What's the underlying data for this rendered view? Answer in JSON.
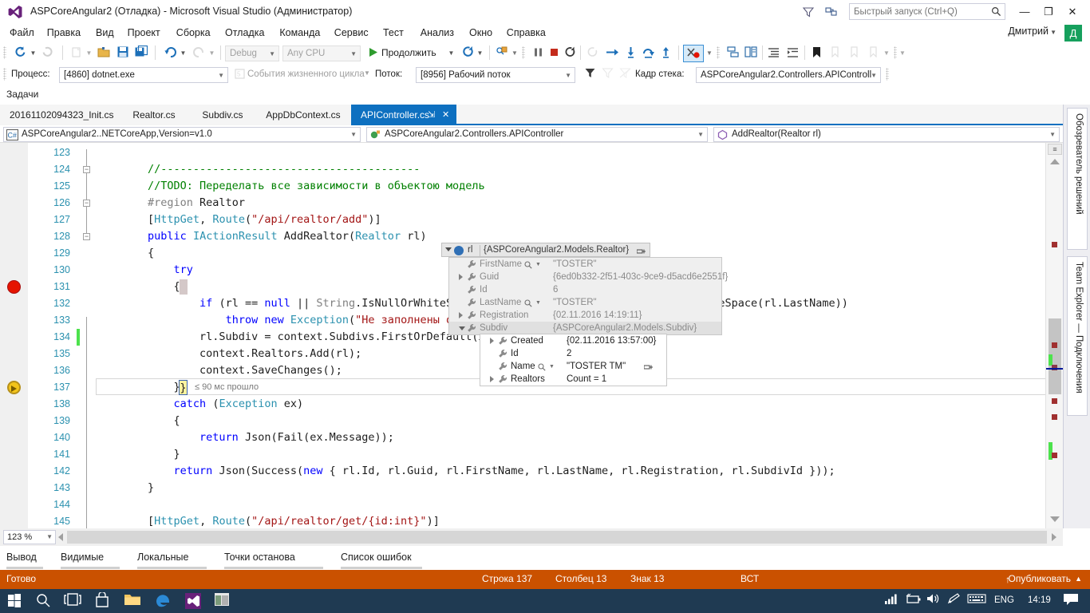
{
  "titlebar": {
    "title": "ASPCoreAngular2 (Отладка) - Microsoft Visual Studio (Администратор)",
    "quick_launch_placeholder": "Быстрый запуск (Ctrl+Q)",
    "minimize": "—",
    "maximize": "❐",
    "close": "✕"
  },
  "menu": {
    "items": [
      "Файл",
      "Правка",
      "Вид",
      "Проект",
      "Сборка",
      "Отладка",
      "Команда",
      "Сервис",
      "Тест",
      "Анализ",
      "Окно",
      "Справка"
    ]
  },
  "account": {
    "name": "Дмитрий",
    "avatar_initial": "Д"
  },
  "toolbar": {
    "config": "Debug",
    "platform": "Any CPU",
    "continue_label": "Продолжить",
    "process_label": "Процесс:",
    "process_value": "[4860] dotnet.exe",
    "lifecycle_label": "События жизненного цикла",
    "thread_label": "Поток:",
    "thread_value": "[8956] Рабочий поток",
    "stackframe_label": "Кадр стека:",
    "stackframe_value": "ASPCoreAngular2.Controllers.APIControll"
  },
  "tasks_label": "Задачи",
  "tabs": {
    "items": [
      {
        "label": "20161102094323_Init.cs",
        "active": false
      },
      {
        "label": "Realtor.cs",
        "active": false
      },
      {
        "label": "Subdiv.cs",
        "active": false
      },
      {
        "label": "AppDbContext.cs",
        "active": false
      },
      {
        "label": "APIController.cs",
        "active": true
      }
    ],
    "pin_glyph": "⇲",
    "close_glyph": "✕"
  },
  "navbar": {
    "project": "ASPCoreAngular2..NETCoreApp,Version=v1.0",
    "type": "ASPCoreAngular2.Controllers.APIController",
    "member": "AddRealtor(Realtor rl)"
  },
  "editor": {
    "zoom": "123 %",
    "lines": [
      {
        "num": "123",
        "segments": []
      },
      {
        "num": "124",
        "fold": "minus",
        "segments": [
          {
            "t": "        //----------------------------------------",
            "c": "c"
          }
        ]
      },
      {
        "num": "125",
        "segments": [
          {
            "t": "        //TODO: Переделать все зависимости в объектою модель",
            "c": "c"
          }
        ]
      },
      {
        "num": "126",
        "fold": "minus",
        "segments": [
          {
            "t": "        #region",
            "c": "p"
          },
          {
            "t": " Realtor",
            "c": "n"
          }
        ]
      },
      {
        "num": "127",
        "segments": [
          {
            "t": "        [",
            "c": "n"
          },
          {
            "t": "HttpGet",
            "c": "t"
          },
          {
            "t": ", ",
            "c": "n"
          },
          {
            "t": "Route",
            "c": "t"
          },
          {
            "t": "(",
            "c": "n"
          },
          {
            "t": "\"/api/realtor/add\"",
            "c": "s"
          },
          {
            "t": ")]",
            "c": "n"
          }
        ]
      },
      {
        "num": "128",
        "fold": "minus",
        "segments": [
          {
            "t": "        ",
            "c": "n"
          },
          {
            "t": "public",
            "c": "k"
          },
          {
            "t": " ",
            "c": "n"
          },
          {
            "t": "IActionResult",
            "c": "t"
          },
          {
            "t": " AddRealtor(",
            "c": "n"
          },
          {
            "t": "Realtor",
            "c": "t"
          },
          {
            "t": " rl)",
            "c": "n"
          }
        ]
      },
      {
        "num": "129",
        "segments": [
          {
            "t": "        {",
            "c": "n"
          }
        ]
      },
      {
        "num": "130",
        "segments": [
          {
            "t": "            ",
            "c": "n"
          },
          {
            "t": "try",
            "c": "k"
          }
        ]
      },
      {
        "num": "131",
        "breakpoint": true,
        "segments": [
          {
            "t": "            {",
            "c": "n"
          }
        ]
      },
      {
        "num": "132",
        "segments": [
          {
            "t": "                ",
            "c": "n"
          },
          {
            "t": "if",
            "c": "k"
          },
          {
            "t": " (rl == ",
            "c": "n"
          },
          {
            "t": "null",
            "c": "k"
          },
          {
            "t": " || ",
            "c": "n"
          },
          {
            "t": "String",
            "c": "p"
          },
          {
            "t": ".IsNullOrWhiteSpace(rl.FirstName) || ",
            "c": "n"
          },
          {
            "t": "String",
            "c": "p"
          },
          {
            "t": ".IsNullOrWhiteSpace(rl.LastName))",
            "c": "n"
          }
        ]
      },
      {
        "num": "133",
        "segments": [
          {
            "t": "                    ",
            "c": "n"
          },
          {
            "t": "throw",
            "c": "k"
          },
          {
            "t": " ",
            "c": "n"
          },
          {
            "t": "new",
            "c": "k"
          },
          {
            "t": " ",
            "c": "n"
          },
          {
            "t": "Exception",
            "c": "t"
          },
          {
            "t": "(",
            "c": "n"
          },
          {
            "t": "\"Не заполнены обязательные поля\"",
            "c": "s"
          },
          {
            "t": ");",
            "c": "n"
          }
        ]
      },
      {
        "num": "134",
        "changed": true,
        "segments": [
          {
            "t": "                rl.Subdiv = context.Subdivs.FirstOrDefault(x => x.Id == rl.SubdivId);",
            "c": "n"
          }
        ]
      },
      {
        "num": "135",
        "segments": [
          {
            "t": "                context.Realtors.Add(rl);",
            "c": "n"
          }
        ]
      },
      {
        "num": "136",
        "segments": [
          {
            "t": "                context.SaveChanges();",
            "c": "n"
          }
        ]
      },
      {
        "num": "137",
        "current": true,
        "perftip": "≤ 90 мс прошло",
        "segments": [
          {
            "t": "            }",
            "c": "n"
          }
        ]
      },
      {
        "num": "138",
        "segments": [
          {
            "t": "            ",
            "c": "n"
          },
          {
            "t": "catch",
            "c": "k"
          },
          {
            "t": " (",
            "c": "n"
          },
          {
            "t": "Exception",
            "c": "t"
          },
          {
            "t": " ex)",
            "c": "n"
          }
        ]
      },
      {
        "num": "139",
        "segments": [
          {
            "t": "            {",
            "c": "n"
          }
        ]
      },
      {
        "num": "140",
        "segments": [
          {
            "t": "                ",
            "c": "n"
          },
          {
            "t": "return",
            "c": "k"
          },
          {
            "t": " Json(Fail(ex.Message));",
            "c": "n"
          }
        ]
      },
      {
        "num": "141",
        "segments": [
          {
            "t": "            }",
            "c": "n"
          }
        ]
      },
      {
        "num": "142",
        "segments": [
          {
            "t": "            ",
            "c": "n"
          },
          {
            "t": "return",
            "c": "k"
          },
          {
            "t": " Json(Success(",
            "c": "n"
          },
          {
            "t": "new",
            "c": "k"
          },
          {
            "t": " { rl.Id, rl.Guid, rl.FirstName, rl.LastName, rl.Registration, rl.SubdivId }));",
            "c": "n"
          }
        ]
      },
      {
        "num": "143",
        "segments": [
          {
            "t": "        }",
            "c": "n"
          }
        ]
      },
      {
        "num": "144",
        "segments": []
      },
      {
        "num": "145",
        "segments": [
          {
            "t": "        [",
            "c": "n"
          },
          {
            "t": "HttpGet",
            "c": "t"
          },
          {
            "t": ", ",
            "c": "n"
          },
          {
            "t": "Route",
            "c": "t"
          },
          {
            "t": "(",
            "c": "n"
          },
          {
            "t": "\"/api/realtor/get/{id:int}\"",
            "c": "s"
          },
          {
            "t": ")]",
            "c": "n"
          }
        ]
      }
    ]
  },
  "datatip": {
    "var_name": "rl",
    "var_type": "{ASPCoreAngular2.Models.Realtor}",
    "rows": [
      {
        "name": "FirstName",
        "value": "\"TOSTER\"",
        "expander": "none",
        "magnifier": true
      },
      {
        "name": "Guid",
        "value": "{6ed0b332-2f51-403c-9ce9-d5acd6e2551f}",
        "expander": "closed",
        "magnifier": false
      },
      {
        "name": "Id",
        "value": "6",
        "expander": "none",
        "magnifier": false
      },
      {
        "name": "LastName",
        "value": "\"TOSTER\"",
        "expander": "none",
        "magnifier": true
      },
      {
        "name": "Registration",
        "value": "{02.11.2016 14:19:11}",
        "expander": "closed",
        "magnifier": false
      },
      {
        "name": "Subdiv",
        "value": "{ASPCoreAngular2.Models.Subdiv}",
        "expander": "open",
        "magnifier": false,
        "selected": true
      }
    ],
    "sub_rows": [
      {
        "name": "Created",
        "value": "{02.11.2016 13:57:00}",
        "expander": "closed",
        "magnifier": false
      },
      {
        "name": "Id",
        "value": "2",
        "expander": "none",
        "magnifier": false
      },
      {
        "name": "Name",
        "value": "\"TOSTER TM\"",
        "expander": "none",
        "magnifier": true,
        "pin": true
      },
      {
        "name": "Realtors",
        "value": "Count = 1",
        "expander": "closed",
        "magnifier": false
      }
    ]
  },
  "right_dock": {
    "tabs": [
      "Обозреватель решений",
      "Team Explorer — Подключения"
    ]
  },
  "tool_windows": {
    "tabs": [
      "Вывод",
      "Видимые",
      "Локальные",
      "Точки останова",
      "Список ошибок"
    ]
  },
  "statusbar": {
    "state": "Готово",
    "line": "Строка 137",
    "column": "Столбец 13",
    "char": "Знак 13",
    "insert_mode": "ВСТ",
    "publish": "Опубликовать",
    "publish_arrow": "↑",
    "caret": "▲"
  },
  "taskbar": {
    "language": "ENG",
    "clock": "14:19"
  },
  "colors": {
    "accent_blue": "#0e70c0",
    "status_orange": "#ca5100",
    "taskbar": "#1f3a52",
    "keyword": "#0000ff",
    "type": "#2b91af",
    "string": "#a31515",
    "comment": "#008000",
    "breakpoint_red": "#e51400",
    "current_line_yellow": "#f3c41b",
    "change_green": "#4de24d",
    "avatar_green": "#16a05d"
  }
}
